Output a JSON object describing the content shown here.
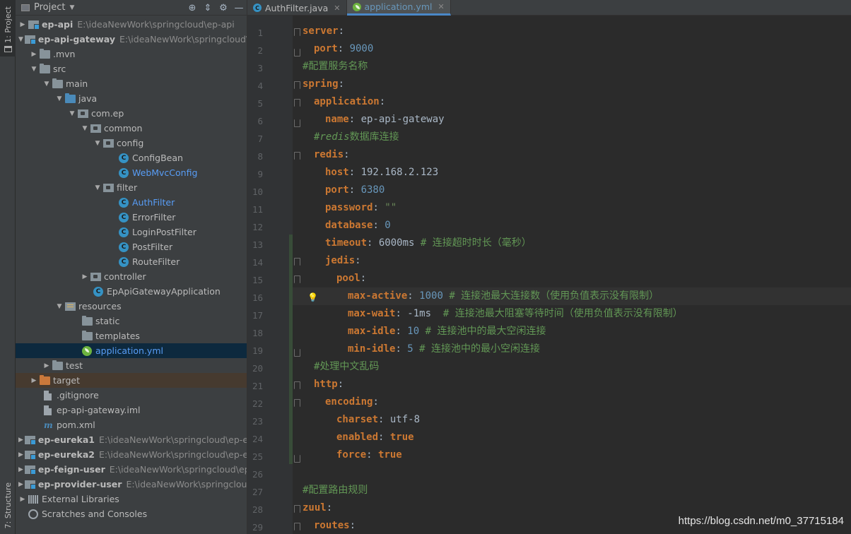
{
  "sidebar": {
    "project_tab": "1: Project",
    "structure_tab": "7: Structure"
  },
  "project_panel": {
    "title": "Project",
    "tree": [
      {
        "label": "ep-api",
        "path": "E:\\ideaNewWork\\springcloud\\ep-api"
      },
      {
        "label": "ep-api-gateway",
        "path": "E:\\ideaNewWork\\springcloud\\ep"
      },
      {
        "label": ".mvn"
      },
      {
        "label": "src"
      },
      {
        "label": "main"
      },
      {
        "label": "java"
      },
      {
        "label": "com.ep"
      },
      {
        "label": "common"
      },
      {
        "label": "config"
      },
      {
        "label": "ConfigBean"
      },
      {
        "label": "WebMvcConfig"
      },
      {
        "label": "filter"
      },
      {
        "label": "AuthFilter"
      },
      {
        "label": "ErrorFilter"
      },
      {
        "label": "LoginPostFilter"
      },
      {
        "label": "PostFilter"
      },
      {
        "label": "RouteFilter"
      },
      {
        "label": "controller"
      },
      {
        "label": "EpApiGatewayApplication"
      },
      {
        "label": "resources"
      },
      {
        "label": "static"
      },
      {
        "label": "templates"
      },
      {
        "label": "application.yml"
      },
      {
        "label": "test"
      },
      {
        "label": "target"
      },
      {
        "label": ".gitignore"
      },
      {
        "label": "ep-api-gateway.iml"
      },
      {
        "label": "pom.xml"
      },
      {
        "label": "ep-eureka1",
        "path": "E:\\ideaNewWork\\springcloud\\ep-eur"
      },
      {
        "label": "ep-eureka2",
        "path": "E:\\ideaNewWork\\springcloud\\ep-eur"
      },
      {
        "label": "ep-feign-user",
        "path": "E:\\ideaNewWork\\springcloud\\ep-f"
      },
      {
        "label": "ep-provider-user",
        "path": "E:\\ideaNewWork\\springcloud\\"
      },
      {
        "label": "External Libraries"
      },
      {
        "label": "Scratches and Consoles"
      }
    ]
  },
  "tabs": [
    {
      "label": "AuthFilter.java",
      "icon": "class-icon"
    },
    {
      "label": "application.yml",
      "icon": "spring-icon"
    }
  ],
  "editor": {
    "line_numbers": [
      "1",
      "2",
      "3",
      "4",
      "5",
      "6",
      "7",
      "8",
      "9",
      "10",
      "11",
      "12",
      "13",
      "14",
      "15",
      "16",
      "17",
      "18",
      "19",
      "20",
      "21",
      "22",
      "23",
      "24",
      "25",
      "26",
      "27",
      "28",
      "29"
    ],
    "lines": [
      {
        "key": "server",
        "sep": ":"
      },
      {
        "key": "port",
        "sep": ": ",
        "num": "9000"
      },
      {
        "comment": "#配置服务名称"
      },
      {
        "key": "spring",
        "sep": ":"
      },
      {
        "key": "application",
        "sep": ":"
      },
      {
        "key": "name",
        "sep": ": ",
        "val": "ep-api-gateway"
      },
      {
        "comment_italic": "#redis",
        "comment": "数据库连接"
      },
      {
        "key": "redis",
        "sep": ":"
      },
      {
        "key": "host",
        "sep": ": ",
        "val": "192.168.2.123"
      },
      {
        "key": "port",
        "sep": ": ",
        "num": "6380"
      },
      {
        "key": "password",
        "sep": ": ",
        "str": "\"\""
      },
      {
        "key": "database",
        "sep": ": ",
        "num": "0"
      },
      {
        "key": "timeout",
        "sep": ": ",
        "val": "6000ms ",
        "comment": "# 连接超时时长（毫秒）"
      },
      {
        "key": "jedis",
        "sep": ":"
      },
      {
        "key": "pool",
        "sep": ":"
      },
      {
        "key": "max-active",
        "sep": ": ",
        "num": "1000 ",
        "comment": "# 连接池最大连接数（使用负值表示没有限制）"
      },
      {
        "key": "max-wait",
        "sep": ": ",
        "val": "-1ms  ",
        "comment": "# 连接池最大阻塞等待时间（使用负值表示没有限制）"
      },
      {
        "key": "max-idle",
        "sep": ": ",
        "num": "10 ",
        "comment": "# 连接池中的最大空闲连接"
      },
      {
        "key": "min-idle",
        "sep": ": ",
        "num": "5 ",
        "comment": "# 连接池中的最小空闲连接"
      },
      {
        "comment": "#处理中文乱码"
      },
      {
        "key": "http",
        "sep": ":"
      },
      {
        "key": "encoding",
        "sep": ":"
      },
      {
        "key": "charset",
        "sep": ": ",
        "val": "utf-8"
      },
      {
        "key": "enabled",
        "sep": ": ",
        "kw": "true"
      },
      {
        "key": "force",
        "sep": ": ",
        "kw": "true"
      },
      {},
      {
        "comment": "#配置路由规则"
      },
      {
        "key": "zuul",
        "sep": ":"
      },
      {
        "key": "routes",
        "sep": ":"
      }
    ]
  },
  "watermark": "https://blog.csdn.net/m0_37715184"
}
